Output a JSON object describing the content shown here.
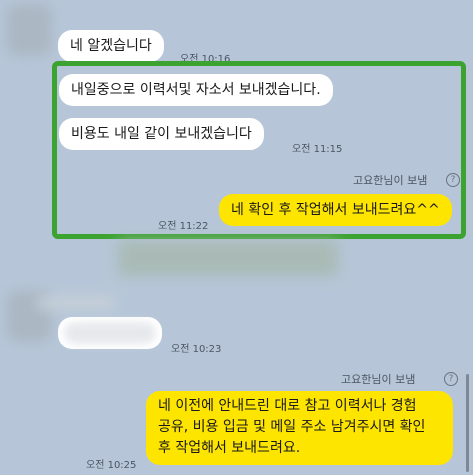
{
  "messages": {
    "m1": {
      "text": "네 알겠습니다",
      "time": "오전 10:16"
    },
    "m2": {
      "text": "내일중으로 이력서및 자소서 보내겠습니다."
    },
    "m3": {
      "text": "비용도 내일 같이 보내겠습니다",
      "time": "오전 11:15"
    },
    "m4": {
      "sender": "고요한님이 보냄",
      "text": "네 확인 후 작업해서 보내드려요^^",
      "time": "오전 11:22"
    },
    "m5": {
      "text": "",
      "time": "오전 10:23"
    },
    "m6": {
      "sender": "고요한님이 보냄",
      "line1": "네 이전에 안내드린 대로 참고 이력서나 경험",
      "line2": "공유, 비용 입금 및 메일 주소 남겨주시면 확인",
      "line3": "후 작업해서 보내드려요.",
      "time": "오전 10:25"
    }
  },
  "help_glyph": "?",
  "colors": {
    "background": "#b6c6d8",
    "my_bubble": "#fee500",
    "their_bubble": "#ffffff",
    "highlight_border": "#3ca330"
  }
}
